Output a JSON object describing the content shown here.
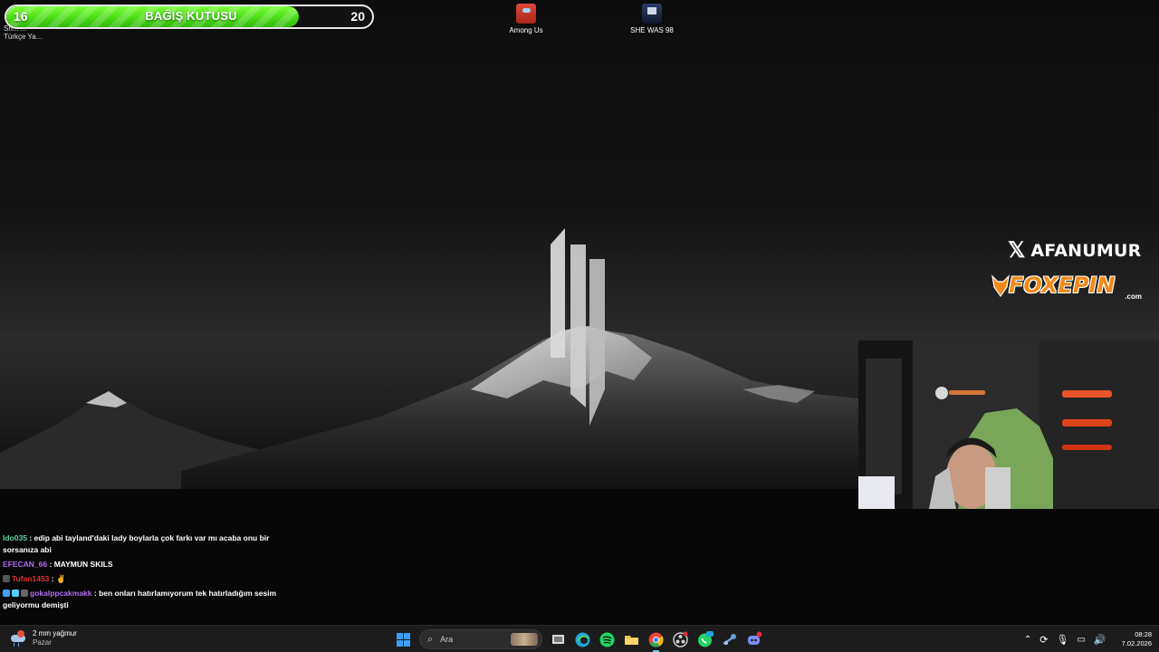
{
  "donation": {
    "current": "16",
    "title": "BAĞIŞ KUTUSU",
    "goal": "20",
    "progress_fraction": 0.8,
    "fill_color": "#4fe01a"
  },
  "desktop": {
    "small_labels": [
      "Sh... ...",
      "Türkçe Ya..."
    ],
    "icons": [
      {
        "label": "Among Us",
        "icon": "among-us-icon"
      },
      {
        "label": "SHE WAS 98",
        "icon": "she-was-98-icon"
      }
    ]
  },
  "brand": {
    "x_icon": "x-logo-icon",
    "handle": "AFANUMUR",
    "sponsor_name": "FOXEPIN",
    "sponsor_sub": ".com",
    "sponsor_color": "#f08a1c"
  },
  "chat": {
    "messages": [
      {
        "user": "Ido035",
        "user_color": "#5fd3a0",
        "text": " : edip abi tayland'daki lady boylarla çok farkı var mı acaba onu bir sorsanıza abi",
        "badges": []
      },
      {
        "user": "EFECAN_66",
        "user_color": "#b06cf0",
        "text": " : MAYMUN SKILS",
        "badges": []
      },
      {
        "user": "Tufan1453",
        "user_color": "#e0303a",
        "text": " : ✌",
        "badges": [
          "badge"
        ]
      },
      {
        "user": "gokalppcakmakk",
        "user_color": "#b06cf0",
        "text": " : ben onları hatırlamıyorum tek hatırladığım sesim geliyormu demişti",
        "badges": [
          "badge",
          "badge",
          "badge"
        ]
      }
    ]
  },
  "taskbar": {
    "weather": {
      "line1": "2 mm yağmur",
      "line2": "Pazar",
      "icon": "rain-cloud-icon"
    },
    "search_placeholder": "Ara",
    "apps": [
      {
        "name": "windows-start-icon",
        "color": "#3aa0ff"
      },
      {
        "name": "task-view-icon",
        "color": "#d9d9d9"
      },
      {
        "name": "edge-icon",
        "color": "#1ea4d8"
      },
      {
        "name": "spotify-icon",
        "color": "#1ed760"
      },
      {
        "name": "file-explorer-icon",
        "color": "#f5c242"
      },
      {
        "name": "chrome-icon",
        "color": "#e94235"
      },
      {
        "name": "obs-icon",
        "color": "#cfcfcf"
      },
      {
        "name": "whatsapp-icon",
        "color": "#25d366"
      },
      {
        "name": "steam-icon",
        "color": "#6aa0d8"
      },
      {
        "name": "discord-icon",
        "color": "#7d8cf5"
      }
    ],
    "tray_icons": [
      "chevron-up-icon",
      "network-sync-icon",
      "microphone-icon",
      "display-icon",
      "volume-icon"
    ],
    "time": "08:28",
    "date": "7.02.2026"
  }
}
